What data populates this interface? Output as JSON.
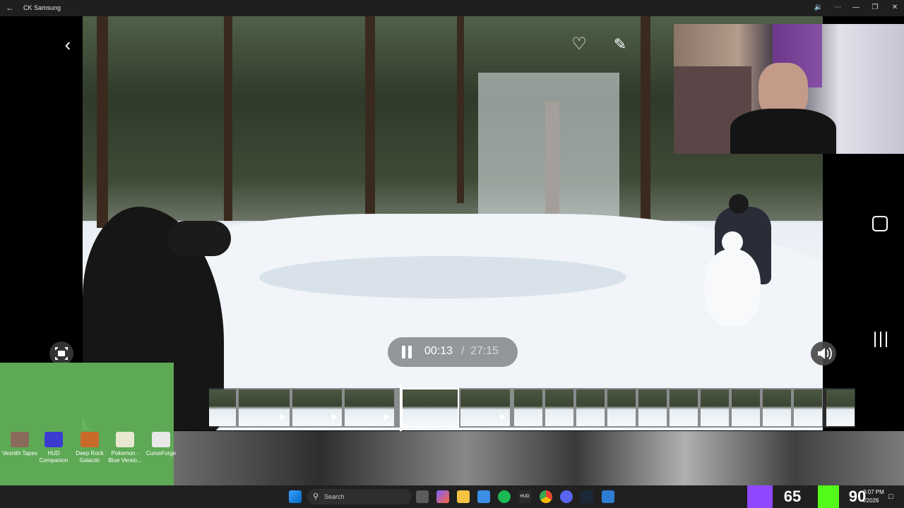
{
  "window": {
    "title": "CK Samsung"
  },
  "player": {
    "time_current": "00:13",
    "time_separator": "/",
    "time_total": "27:15"
  },
  "timeline": {
    "thumb_count": 20,
    "selected_index": 4,
    "played_fraction": 0.008
  },
  "desktop_icons": [
    {
      "label": "Vesnith Tapes",
      "color": "#8a6a5a"
    },
    {
      "label": "HUD Companion",
      "color": "#3b3bd0"
    },
    {
      "label": "Deep Rock Galactic",
      "color": "#c86a2a"
    },
    {
      "label": "Pokemon - Blue Versio...",
      "color": "#e8e8d0"
    },
    {
      "label": "CurseForge",
      "color": "#e8e8e8"
    }
  ],
  "taskbar": {
    "search_label": "Search",
    "clock_time": "3:07 PM",
    "clock_date": "4/2026",
    "twitch_count": "65",
    "kick_count": "90"
  },
  "colors": {
    "accent_green": "#62b05a",
    "twitch": "#9146ff",
    "kick": "#53fc18"
  }
}
